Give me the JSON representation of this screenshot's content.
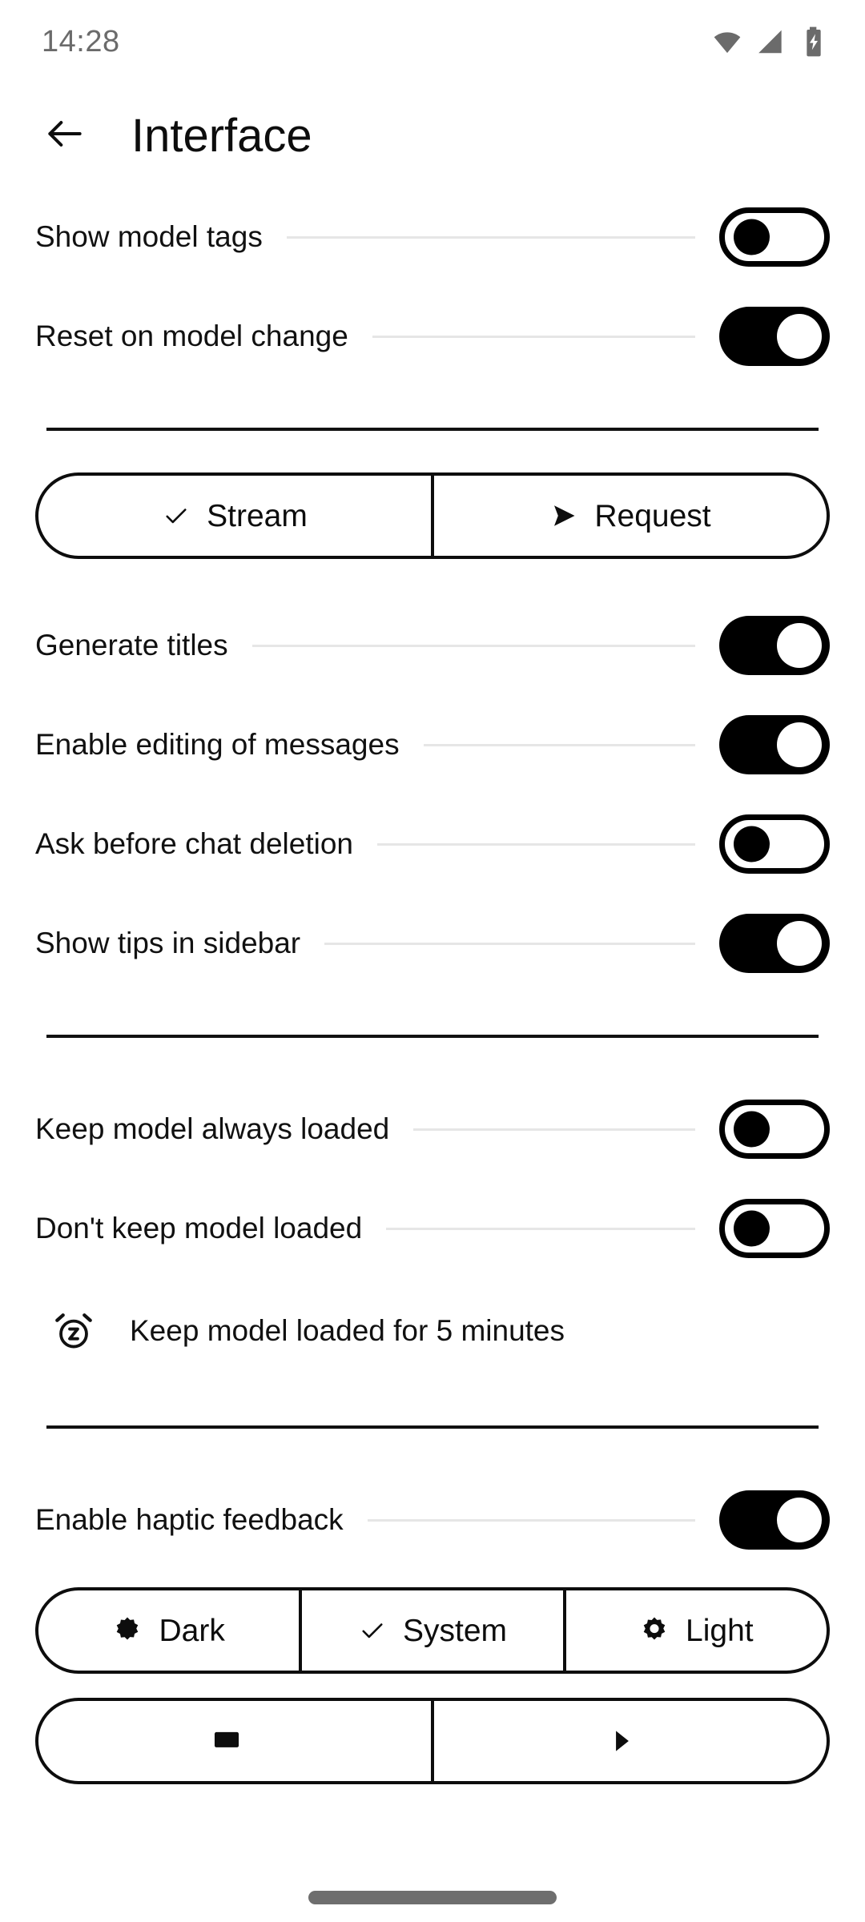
{
  "status_bar": {
    "time": "14:28",
    "icons": [
      "wifi-icon",
      "cellular-signal-icon",
      "battery-charging-icon"
    ]
  },
  "app_bar": {
    "back_icon": "arrow-left-icon",
    "title": "Interface"
  },
  "colors": {
    "background": "#ffffff",
    "text": "#111111",
    "accent": "#000000",
    "leader_line": "#e6e6e6",
    "divider": "#111111",
    "status_text": "#6b6b6b",
    "home_indicator": "#6e6e6e"
  },
  "sections": {
    "group_one": [
      {
        "label": "Show model tags",
        "state": "off"
      },
      {
        "label": "Reset on model change",
        "state": "on"
      }
    ],
    "mode_selector": {
      "options": [
        {
          "label": "Stream",
          "icon": "check-icon",
          "selected": true
        },
        {
          "label": "Request",
          "icon": "send-icon",
          "selected": false
        }
      ]
    },
    "group_two": [
      {
        "label": "Generate titles",
        "state": "on"
      },
      {
        "label": "Enable editing of messages",
        "state": "on"
      },
      {
        "label": "Ask before chat deletion",
        "state": "off"
      },
      {
        "label": "Show tips in sidebar",
        "state": "on"
      }
    ],
    "group_three": [
      {
        "label": "Keep model always loaded",
        "state": "off"
      },
      {
        "label": "Don't keep model loaded",
        "state": "off"
      }
    ],
    "keep_loaded_info": {
      "icon": "alarm-snooze-icon",
      "text": "Keep model loaded for 5 minutes"
    },
    "group_four": [
      {
        "label": "Enable haptic feedback",
        "state": "on"
      }
    ],
    "theme_selector": {
      "options": [
        {
          "label": "Dark",
          "icon": "moon-sun-icon",
          "selected": false
        },
        {
          "label": "System",
          "icon": "check-icon",
          "selected": true
        },
        {
          "label": "Light",
          "icon": "sun-icon",
          "selected": false
        }
      ]
    },
    "bottom_selector": {
      "options": [
        {
          "label": "",
          "icon": "device-icon",
          "selected": false
        },
        {
          "label": "",
          "icon": "all-icon",
          "selected": false
        }
      ]
    }
  }
}
